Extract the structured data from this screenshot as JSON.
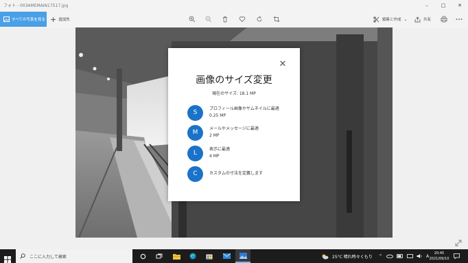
{
  "window": {
    "title": "フォト - 003AMEMAIN17517.jpg",
    "controls": [
      "–",
      "□",
      "✕"
    ]
  },
  "toolbar": {
    "all_photos_label": "すべての写真を見る",
    "add_to_label": "追加先",
    "edit_label": "編集と作成",
    "share_label": "共有",
    "tools": [
      "zoom-in-icon",
      "zoom-out-icon",
      "delete-icon",
      "favorite-icon",
      "rotate-icon",
      "crop-icon"
    ]
  },
  "dialog": {
    "title": "画像のサイズ変更",
    "current_size": "現在のサイズ: 18.1 MP",
    "options": [
      {
        "letter": "S",
        "line1": "プロフィール画像やサムネイルに最適",
        "line2": "0.25 MP"
      },
      {
        "letter": "M",
        "line1": "メールやメッセージに最適",
        "line2": "2 MP"
      },
      {
        "letter": "L",
        "line1": "表示に最適",
        "line2": "4 MP"
      },
      {
        "letter": "C",
        "line1": "カスタムの寸法を定義します",
        "line2": ""
      }
    ],
    "close_glyph": "✕",
    "accent_color": "#1a73c8"
  },
  "taskbar": {
    "search_placeholder": "ここに入力して検索",
    "weather": "25°C 晴れ時々くもり",
    "ime": "A",
    "time": "20:45",
    "date": "2021/09/10"
  }
}
